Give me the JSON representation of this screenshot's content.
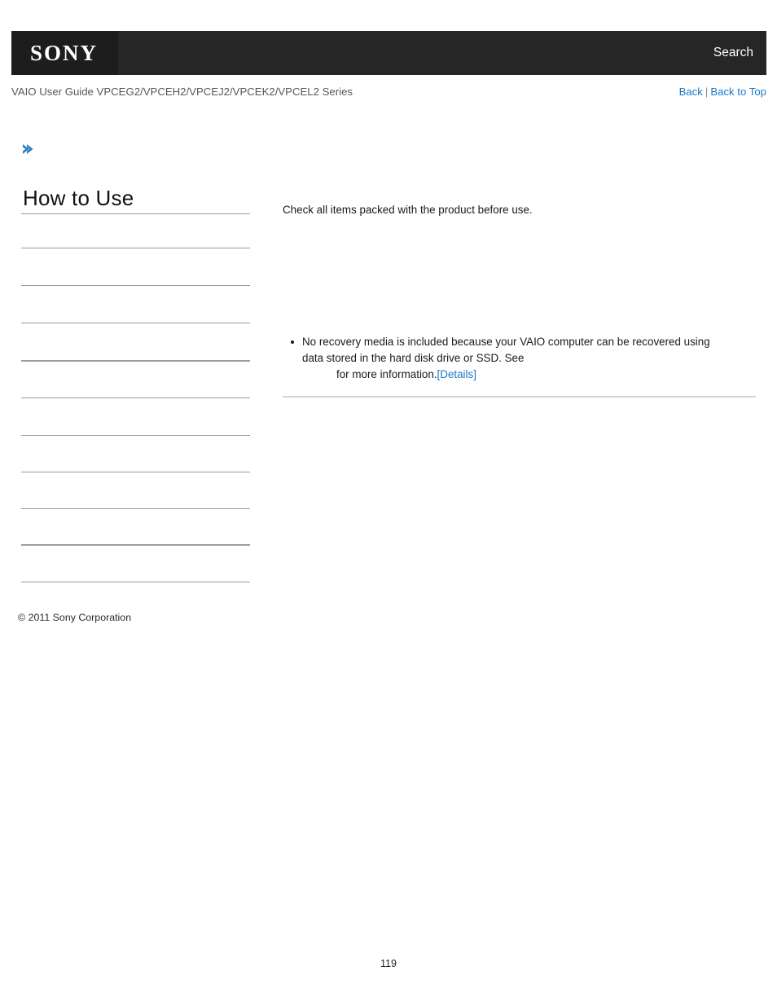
{
  "header": {
    "logo_text": "SONY",
    "search_label": "Search",
    "bar_color": "#262626",
    "logo_block_color": "#1d1d1d"
  },
  "subheader": {
    "guide_title": "VAIO User Guide VPCEG2/VPCEH2/VPCEJ2/VPCEK2/VPCEL2 Series",
    "back_label": "Back",
    "separator": "|",
    "back_to_top_label": "Back to Top",
    "link_color": "#1878c8"
  },
  "breadcrumb": {
    "icon": "chevron-right-icon",
    "icon_color": "#2a7ebb",
    "text": ""
  },
  "sidebar": {
    "title": "How to Use",
    "items": [
      {
        "label": ""
      },
      {
        "label": ""
      },
      {
        "label": ""
      },
      {
        "label": ""
      },
      {
        "label": ""
      },
      {
        "label": ""
      },
      {
        "label": ""
      },
      {
        "label": ""
      },
      {
        "label": ""
      },
      {
        "label": ""
      }
    ]
  },
  "content": {
    "intro": "Check all items packed with the product before use.",
    "notes": [
      {
        "line1": "No recovery media is included because your VAIO computer can be recovered using",
        "line2": "data stored in the hard disk drive or SSD. See",
        "line3_prefix": "for more information.",
        "link_label": "[Details]"
      }
    ]
  },
  "footer": {
    "copyright": "© 2011 Sony Corporation",
    "page_number": "119"
  }
}
